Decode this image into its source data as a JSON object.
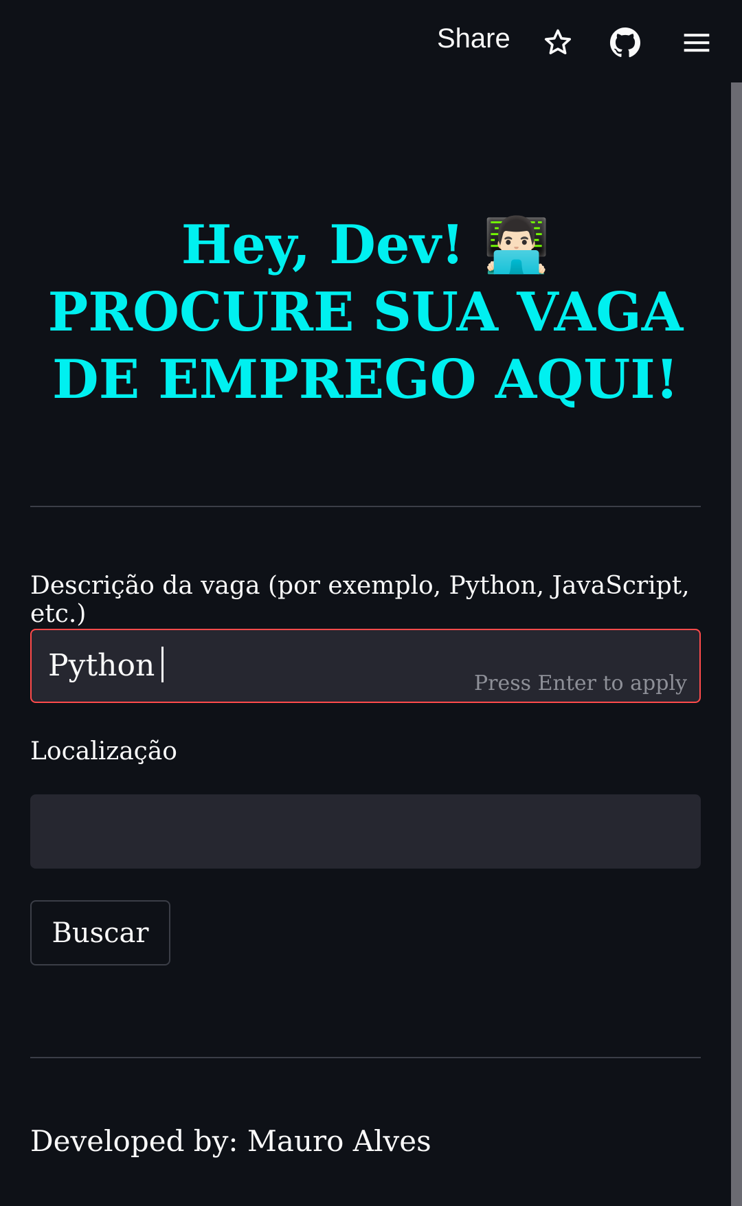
{
  "header": {
    "share_label": "Share",
    "icons": [
      "star-icon",
      "github-icon",
      "menu-icon"
    ]
  },
  "main": {
    "title": "Hey, Dev! 👨🏻‍💻 PROCURE SUA VAGA DE EMPREGO AQUI!",
    "job_field": {
      "label": "Descrição da vaga (por exemplo, Python, JavaScript, etc.)",
      "value": "Python",
      "hint": "Press Enter to apply"
    },
    "location_field": {
      "label": "Localização",
      "value": ""
    },
    "search_button": "Buscar"
  },
  "footer": {
    "credit": "Developed by: Mauro Alves"
  },
  "colors": {
    "background": "#0e1117",
    "title": "#00f0f0",
    "input_bg": "#262730",
    "focus_border": "#ff4b4b"
  }
}
